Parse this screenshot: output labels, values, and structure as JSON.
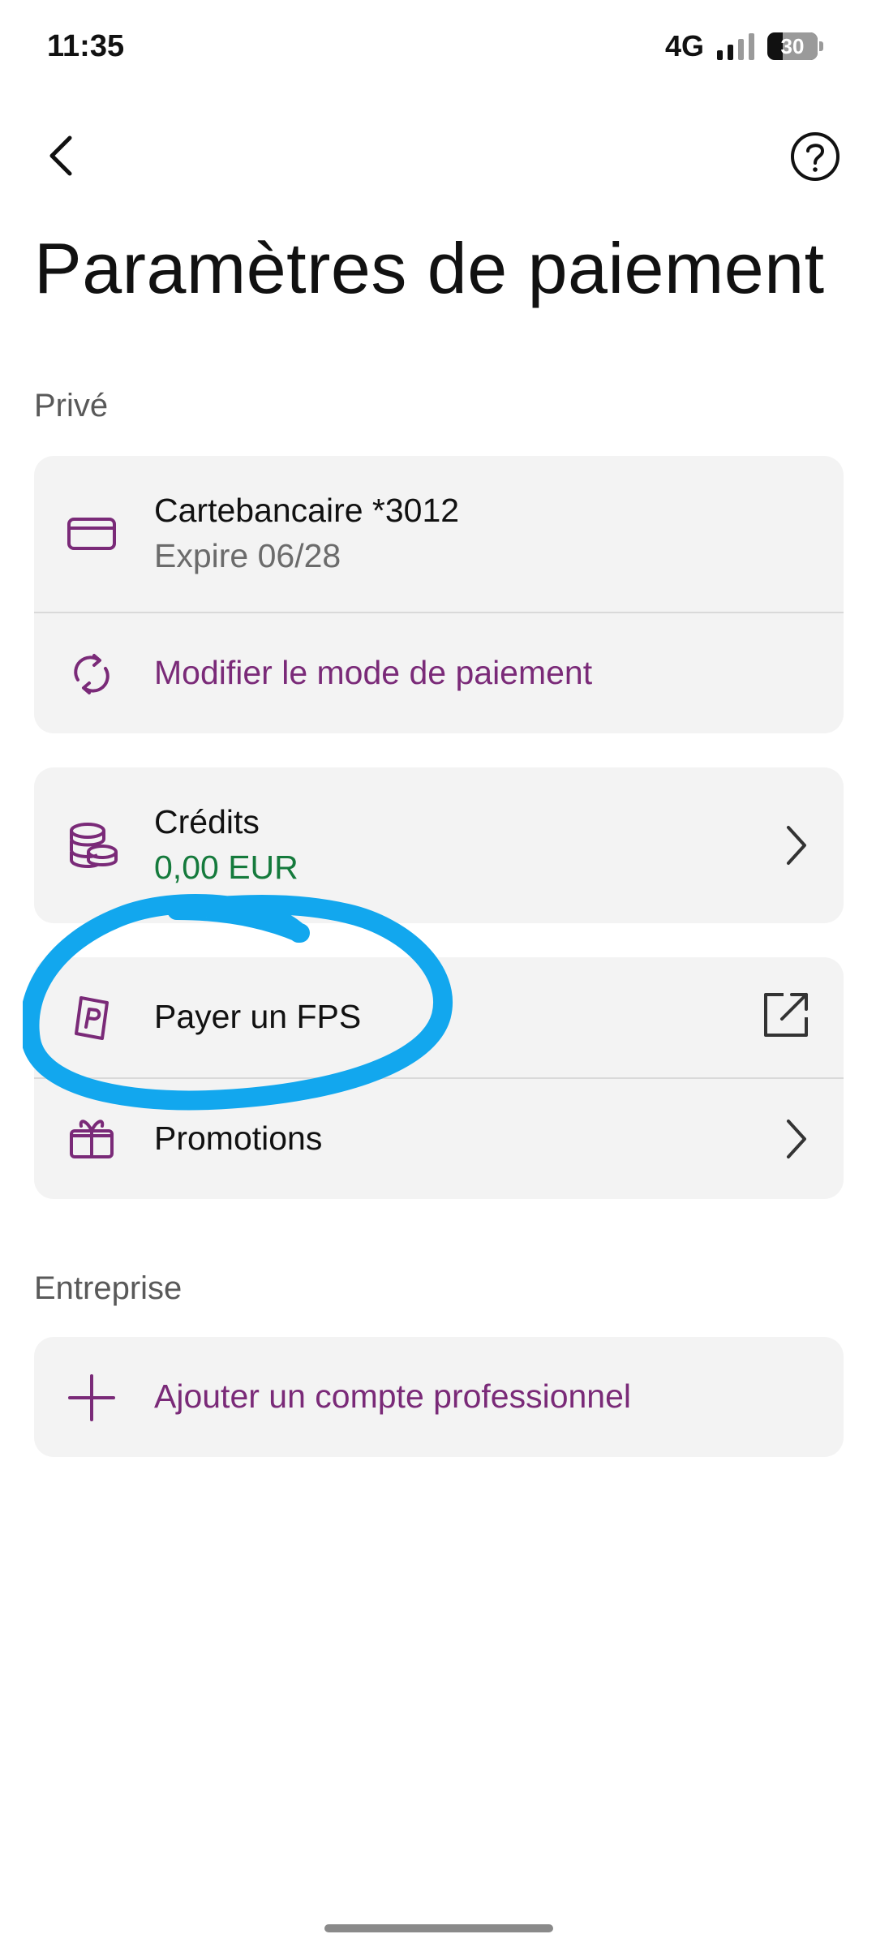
{
  "status_bar": {
    "time": "11:35",
    "network": "4G",
    "battery": "30",
    "signal_bars": 4,
    "signal_bars_filled": 2
  },
  "header": {
    "back_icon": "chevron-left-icon",
    "help_icon": "question-circle-icon",
    "title": "Paramètres de paiement"
  },
  "private_section": {
    "label": "Privé",
    "payment_card": {
      "title": "Cartebancaire *3012",
      "subtitle": "Expire 06/28",
      "icon": "credit-card-icon"
    },
    "change_method": {
      "label": "Modifier le mode de paiement",
      "icon": "refresh-icon"
    },
    "credits": {
      "label": "Crédits",
      "value": "0,00 EUR",
      "icon": "coins-icon"
    },
    "pay_fps": {
      "label": "Payer un FPS",
      "icon": "parking-ticket-icon",
      "action_icon": "external-link-icon"
    },
    "promotions": {
      "label": "Promotions",
      "icon": "gift-icon"
    }
  },
  "business_section": {
    "label": "Entreprise",
    "add_account": {
      "label": "Ajouter un compte professionnel",
      "icon": "plus-icon"
    }
  },
  "colors": {
    "accent": "#7a2a78",
    "credit_value": "#157a3c",
    "card_background": "#f3f3f3",
    "annotation": "#12a7ee"
  }
}
